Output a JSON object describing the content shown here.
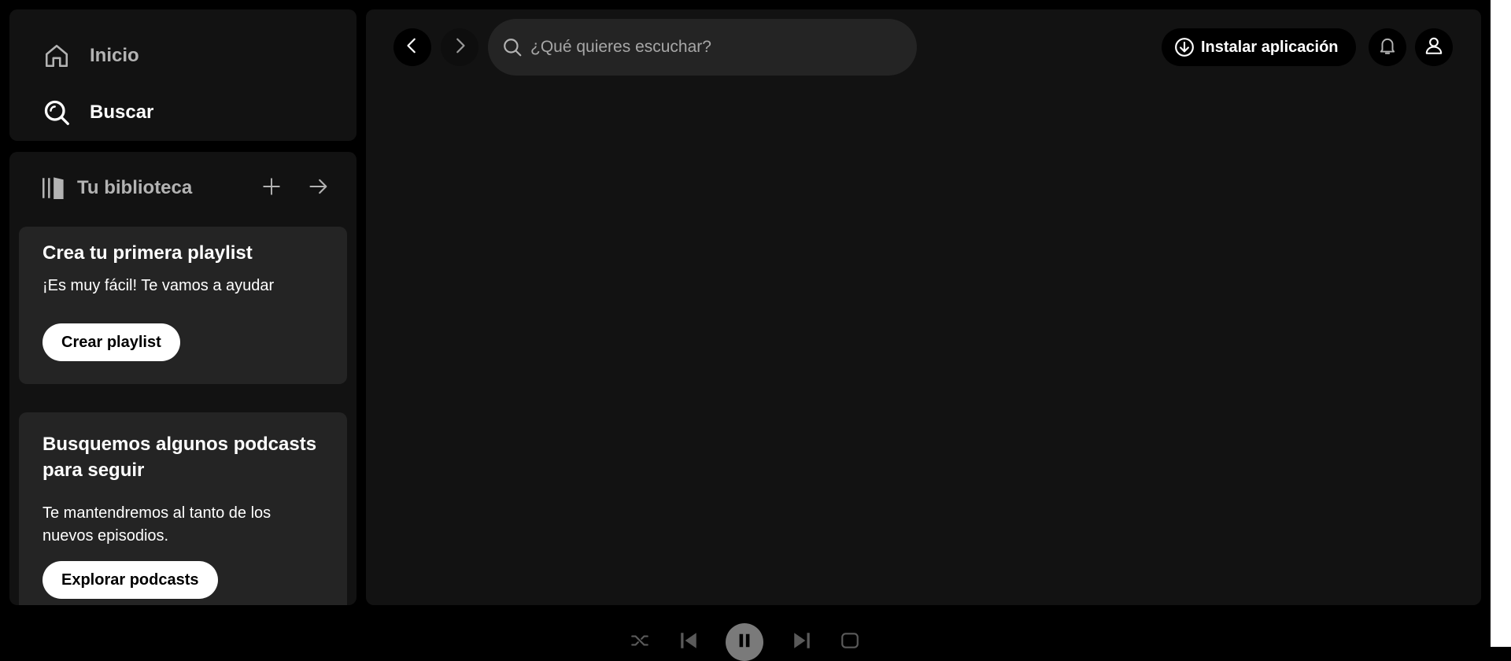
{
  "nav": {
    "home_label": "Inicio",
    "search_label": "Buscar"
  },
  "library": {
    "title": "Tu biblioteca",
    "cards": [
      {
        "title": "Crea tu primera playlist",
        "subtitle": "¡Es muy fácil! Te vamos a ayudar",
        "button": "Crear playlist"
      },
      {
        "title": "Busquemos algunos podcasts para seguir",
        "subtitle": "Te mantendremos al tanto de los nuevos episodios.",
        "button": "Explorar podcasts"
      }
    ]
  },
  "topbar": {
    "search_placeholder": "¿Qué quieres escuchar?",
    "install_label": "Instalar aplicación"
  },
  "icons": {
    "home": "home-icon",
    "search": "search-icon",
    "library": "library-icon",
    "add": "plus-icon",
    "expand": "arrow-right-icon",
    "back": "chevron-left-icon",
    "forward": "chevron-right-icon",
    "install": "download-circle-icon",
    "bell": "bell-icon",
    "user": "user-icon",
    "shuffle": "shuffle-icon",
    "prev": "skip-previous-icon",
    "play": "pause-icon",
    "next": "skip-next-icon",
    "repeat": "repeat-icon"
  },
  "colors": {
    "background": "#000000",
    "panel": "#121212",
    "card": "#242424",
    "text_primary": "#ffffff",
    "text_secondary": "#b3b3b3"
  }
}
